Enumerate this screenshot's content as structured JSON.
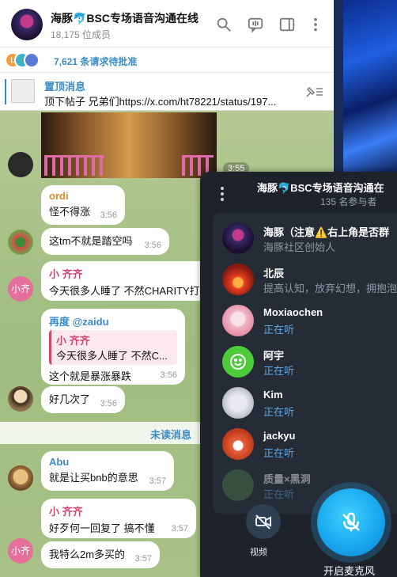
{
  "header": {
    "title": "海豚🐬BSC专场语音沟通在线",
    "members": "18,175 位成员"
  },
  "requests": {
    "text": "7,621 条请求待批准",
    "avatars": [
      "L",
      "",
      ""
    ]
  },
  "pinned": {
    "label": "置顶消息",
    "text": "顶下帖子 兄弟们https://x.com/ht78221/status/197..."
  },
  "media": {
    "time": "3:55"
  },
  "messages": [
    {
      "name": "ordi",
      "text": "怪不得涨",
      "time": "3:56"
    },
    {
      "text": "这tm不就是踏空吗",
      "time": "3:56"
    },
    {
      "name": "小 齐齐",
      "text": "今天很多人睡了 不然CHARITY打",
      "avatar_text": "小齐"
    },
    {
      "name": "再度 @zaidu",
      "quote_name": "小 齐齐",
      "quote_text": "今天很多人睡了 不然C...",
      "text": "这个就是暴涨暴跌",
      "time": "3:56"
    },
    {
      "text": "好几次了",
      "time": "3:56"
    },
    {
      "name": "Abu",
      "text": "就是让买bnb的意思",
      "time": "3:57"
    },
    {
      "name": "小 齐齐",
      "text": "好歹何一回复了  搞不懂",
      "time": "3:57",
      "avatar_text": "小齐"
    },
    {
      "text": "我特么2m多买的",
      "time": "3:57"
    }
  ],
  "unread_label": "未读消息",
  "voice_chat": {
    "title": "海豚🐬BSC专场语音沟通在",
    "count": "135 名参与者",
    "participants": [
      {
        "name": "海豚（注意⚠️右上角是否群",
        "status": "海豚社区创始人"
      },
      {
        "name": "北辰",
        "status": "提高认知，放弃幻想，拥抱泡"
      },
      {
        "name": "Moxiaochen",
        "status": "正在听"
      },
      {
        "name": "阿宇",
        "status": "正在听"
      },
      {
        "name": "Kim",
        "status": "正在听"
      },
      {
        "name": "jackyu",
        "status": "正在听"
      },
      {
        "name": "质量×黑洞",
        "status": "正在听"
      }
    ],
    "video_label": "视频",
    "mic_label": "开启麦克风"
  },
  "colors": {
    "accent": "#3a8bc8",
    "name_ordi": "#e08a2a",
    "name_qiqi": "#d9436b",
    "name_zaidu": "#3a8bc8",
    "name_abu": "#3a8bc8"
  }
}
